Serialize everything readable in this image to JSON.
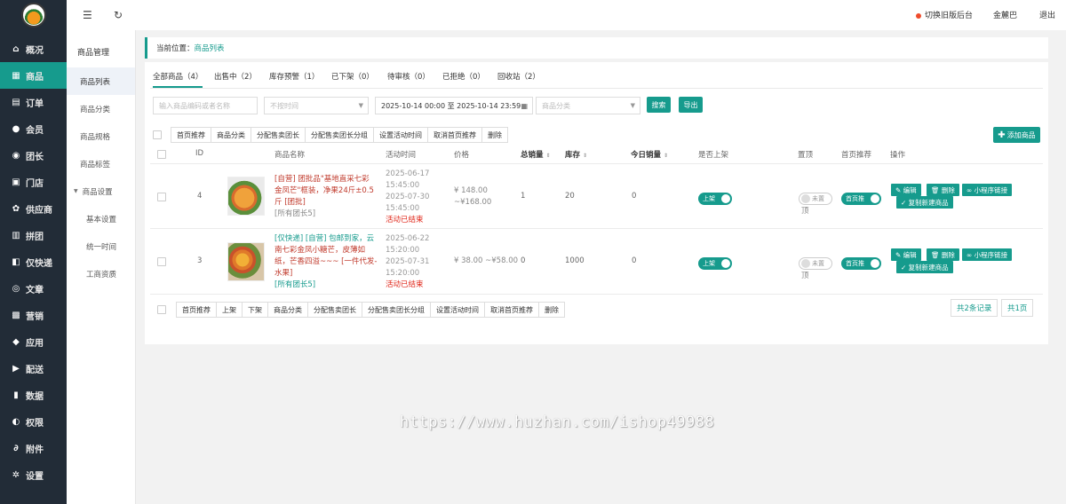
{
  "sidebar": {
    "items": [
      {
        "label": "概况",
        "icon": "home-icon"
      },
      {
        "label": "商品",
        "icon": "shop-icon"
      },
      {
        "label": "订单",
        "icon": "order-icon"
      },
      {
        "label": "会员",
        "icon": "user-icon"
      },
      {
        "label": "团长",
        "icon": "leader-icon"
      },
      {
        "label": "门店",
        "icon": "store-icon"
      },
      {
        "label": "供应商",
        "icon": "supplier-icon"
      },
      {
        "label": "拼团",
        "icon": "group-icon"
      },
      {
        "label": "仅快递",
        "icon": "express-icon"
      },
      {
        "label": "文章",
        "icon": "article-icon"
      },
      {
        "label": "营销",
        "icon": "marketing-icon"
      },
      {
        "label": "应用",
        "icon": "app-icon"
      },
      {
        "label": "配送",
        "icon": "delivery-icon"
      },
      {
        "label": "数据",
        "icon": "data-icon"
      },
      {
        "label": "权限",
        "icon": "permission-icon"
      },
      {
        "label": "附件",
        "icon": "attachment-icon"
      },
      {
        "label": "设置",
        "icon": "settings-icon"
      }
    ]
  },
  "subnav": {
    "title": "商品管理",
    "items": [
      "商品列表",
      "商品分类",
      "商品规格",
      "商品标签"
    ],
    "group": "商品设置",
    "group_items": [
      "基本设置",
      "统一时间",
      "工商资质"
    ]
  },
  "topbar": {
    "switch_label": "切换旧版后台",
    "user": "金麓巴",
    "logout": "退出"
  },
  "breadcrumb": {
    "prefix": "当前位置：",
    "current": "商品列表"
  },
  "tabs": [
    "全部商品（4）",
    "出售中（2）",
    "库存预警（1）",
    "已下架（0）",
    "待审核（0）",
    "已拒绝（0）",
    "回收站（2）"
  ],
  "filters": {
    "search_placeholder": "输入商品编码或者名称",
    "time_placeholder": "不按时间",
    "date_range": "2025-10-14 00:00 至 2025-10-14 23:59",
    "category_placeholder": "商品分类",
    "search_btn": "搜索",
    "export_btn": "导出"
  },
  "bulk_top": [
    "首页推荐",
    "商品分类",
    "分配售卖团长",
    "分配售卖团长分组",
    "设置活动时间",
    "取消首页推荐",
    "删除"
  ],
  "bulk_bottom": [
    "首页推荐",
    "上架",
    "下架",
    "商品分类",
    "分配售卖团长",
    "分配售卖团长分组",
    "设置活动时间",
    "取消首页推荐",
    "删除"
  ],
  "add_btn": "添加商品",
  "headers": {
    "id": "ID",
    "name": "商品名称",
    "time": "活动时间",
    "price": "价格",
    "sales": "总销量",
    "stock": "库存",
    "today": "今日销量",
    "onsale": "是否上架",
    "top": "置顶",
    "home": "首页推荐",
    "ops": "操作"
  },
  "rows": [
    {
      "id": "4",
      "name_lines": [
        "[自营] 团批品\"基地直采七彩",
        "金凤芒\"框装，净果24斤±0.5",
        "斤 [团批]"
      ],
      "name_tail": "[所有团长5]",
      "times": [
        "2025-06-17",
        "15:45:00",
        "2025-07-30",
        "15:45:00"
      ],
      "status": "活动已结束",
      "price_lines": [
        "¥ 148.00",
        "~¥168.00"
      ],
      "sales": "1",
      "stock": "20",
      "today": "0",
      "onsale": "上架",
      "top_lines": [
        "未置",
        "顶"
      ],
      "home": "首页推"
    },
    {
      "id": "3",
      "name_lines": [
        "[仅快递] [自营] 包邮到家，云",
        "南七彩金凤小糖芒，皮薄如",
        "纸，芒香四溢~~~ [一件代发-",
        "水果]"
      ],
      "name_tail": "[所有团长5]",
      "times": [
        "2025-06-22",
        "15:20:00",
        "2025-07-31",
        "15:20:00"
      ],
      "status": "活动已结束",
      "price_lines": [
        "¥ 38.00 ~¥58.00"
      ],
      "sales": "0",
      "stock": "1000",
      "today": "0",
      "onsale": "上架",
      "top_lines": [
        "未置",
        "顶"
      ],
      "home": "首页推"
    }
  ],
  "ops": {
    "edit": "编辑",
    "delete": "删除",
    "miniapp": "小程序链接",
    "copy": "复制新建商品"
  },
  "pagination": {
    "total": "共2条记录",
    "pages": "共1页"
  },
  "watermark": "https://www.huzhan.com/ishop49988"
}
